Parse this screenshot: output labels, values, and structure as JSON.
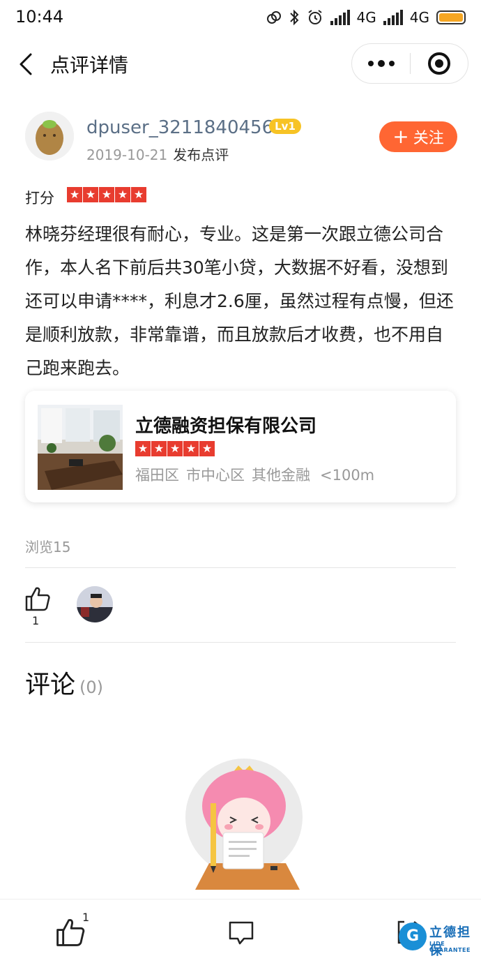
{
  "status_bar": {
    "time": "10:44",
    "network_1": "4G",
    "network_2": "4G"
  },
  "nav": {
    "title": "点评详情"
  },
  "user": {
    "name": "dpuser_3211840456",
    "level": "Lv1",
    "date": "2019-10-21",
    "action": "发布点评",
    "follow_label": "关注"
  },
  "rating": {
    "label": "打分",
    "stars": 5
  },
  "review": {
    "text": "林晓芬经理很有耐心，专业。这是第一次跟立德公司合作，本人名下前后共30笔小贷，大数据不好看，没想到还可以申请****，利息才2.6厘，虽然过程有点慢，但还是顺利放款，非常靠谱，而且放款后才收费，也不用自己跑来跑去。"
  },
  "shop": {
    "name": "立德融资担保有限公司",
    "stars": 5,
    "district": "福田区",
    "area": "市中心区",
    "category": "其他金融",
    "distance": "<100m"
  },
  "stats": {
    "views": "浏览15",
    "like_count": "1"
  },
  "comments": {
    "title": "评论",
    "count": "(0)"
  },
  "bottom_bar": {
    "like_count": "1"
  },
  "watermark": {
    "cn": "立德担保",
    "en": "LIDE GUARANTEE",
    "logo_letter": "G"
  },
  "colors": {
    "accent": "#ff6633",
    "star": "#e83c2f",
    "level_badge": "#f7c325",
    "username": "#5b6f86"
  },
  "icons": [
    "back-arrow-icon",
    "more-dots-icon",
    "close-circle-icon",
    "star-icon",
    "thumbs-up-icon",
    "comment-icon",
    "share-icon"
  ]
}
